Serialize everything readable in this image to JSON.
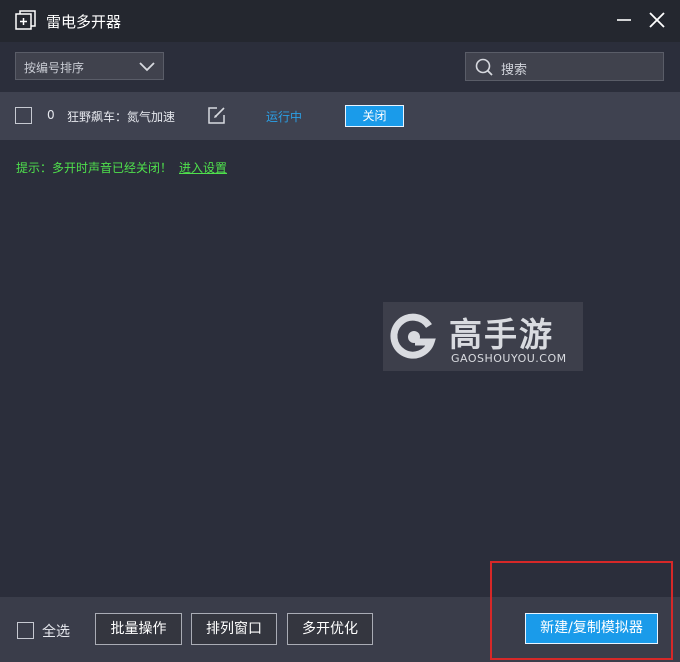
{
  "window": {
    "title": "雷电多开器"
  },
  "toolbar": {
    "sort_label": "按编号排序",
    "search_placeholder": "搜索"
  },
  "instances": [
    {
      "index": "0",
      "name": "狂野飙车：氮气加速",
      "status": "运行中",
      "close_label": "关闭"
    }
  ],
  "hint": {
    "text": "提示：多开时声音已经关闭！",
    "link": "进入设置"
  },
  "watermark": {
    "cn": "高手游",
    "en": "GAOSHOUYOU.COM"
  },
  "footer": {
    "select_all": "全选",
    "batch": "批量操作",
    "arrange": "排列窗口",
    "optimize": "多开优化",
    "new_copy": "新建/复制模拟器"
  },
  "colors": {
    "accent": "#1a9bea",
    "status": "#2b9fe5",
    "hint": "#4fe04c",
    "highlight": "#d62828"
  },
  "icons": [
    "add-window-icon",
    "minimize-icon",
    "close-icon",
    "chevron-down-icon",
    "search-icon",
    "edit-icon",
    "gaoshouyou-logo-icon"
  ]
}
